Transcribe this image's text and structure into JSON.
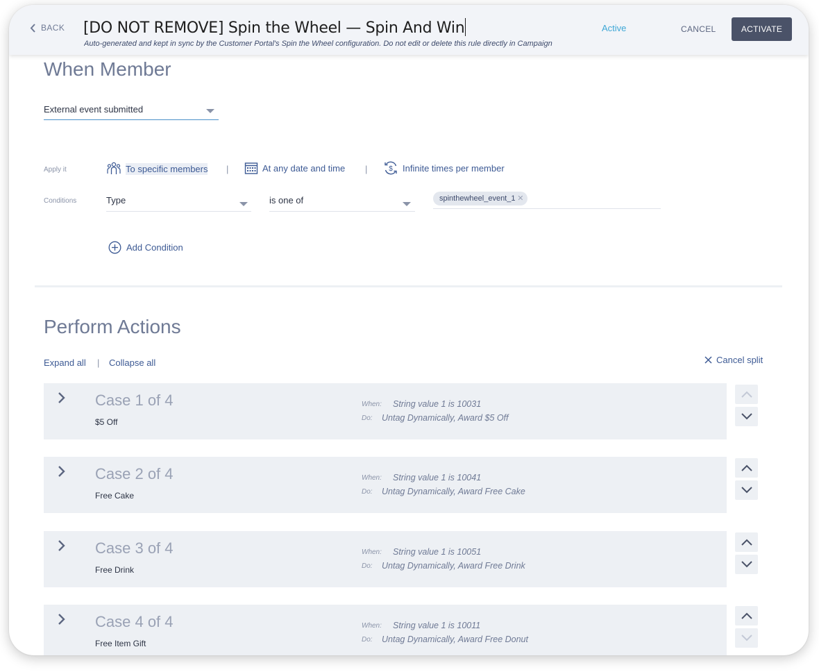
{
  "header": {
    "back_label": "BACK",
    "title": "[DO NOT REMOVE] Spin the Wheel — Spin And Win",
    "subtitle": "Auto-generated and kept in sync by the Customer Portal's Spin the Wheel configuration. Do not edit or delete this rule directly in Campaign",
    "status": "Active",
    "cancel_label": "CANCEL",
    "activate_label": "ACTIVATE"
  },
  "when_member": {
    "title": "When Member",
    "trigger": "External event submitted",
    "apply_label": "Apply it",
    "apply_options": [
      {
        "label": "To specific members",
        "icon": "people-icon"
      },
      {
        "label": "At any date and time",
        "icon": "calendar-icon"
      },
      {
        "label": "Infinite times per member",
        "icon": "repeat-dollar-icon"
      }
    ],
    "separator": "|",
    "conditions_label": "Conditions",
    "condition": {
      "field": "Type",
      "operator": "is one of",
      "values": [
        "spinthewheel_event_1"
      ]
    },
    "add_condition_label": "Add Condition"
  },
  "perform_actions": {
    "title": "Perform Actions",
    "expand_all": "Expand all",
    "collapse_all": "Collapse all",
    "separator": "|",
    "cancel_split": "Cancel split",
    "when_label": "When:",
    "do_label": "Do:",
    "cases": [
      {
        "title": "Case 1 of 4",
        "name": "$5 Off",
        "when": "String value 1 is 10031",
        "do": "Untag Dynamically, Award $5 Off"
      },
      {
        "title": "Case 2 of 4",
        "name": "Free Cake",
        "when": "String value 1 is 10041",
        "do": "Untag Dynamically, Award Free Cake"
      },
      {
        "title": "Case 3 of 4",
        "name": "Free Drink",
        "when": "String value 1 is 10051",
        "do": "Untag Dynamically, Award Free Drink"
      },
      {
        "title": "Case 4 of 4",
        "name": "Free Item Gift",
        "when": "String value 1 is 10011",
        "do": "Untag Dynamically, Award Free Donut"
      }
    ]
  },
  "colors": {
    "accent": "#3d5a94",
    "status_active": "#3fa7d6",
    "primary_button": "#4a5268",
    "case_bg": "#edf0f4"
  }
}
